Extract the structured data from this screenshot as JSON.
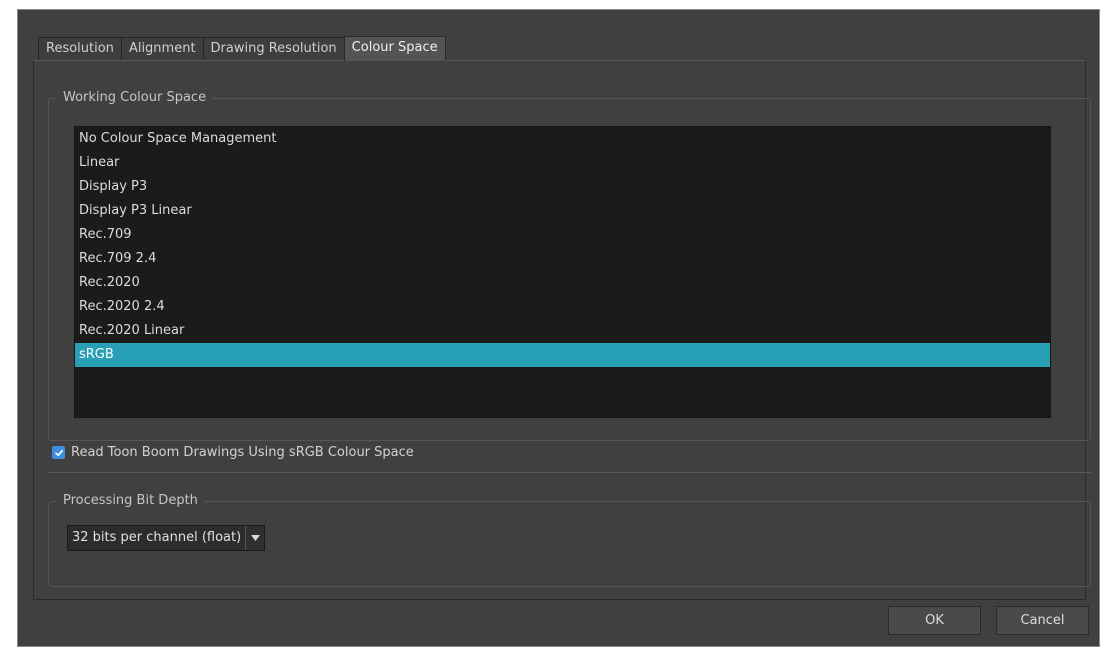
{
  "tabs": [
    "Resolution",
    "Alignment",
    "Drawing Resolution",
    "Colour Space"
  ],
  "active_tab": "Colour Space",
  "working_colour_space": {
    "title": "Working Colour Space",
    "items": [
      "No Colour Space Management",
      "Linear",
      "Display P3",
      "Display P3 Linear",
      "Rec.709",
      "Rec.709 2.4",
      "Rec.2020",
      "Rec.2020 2.4",
      "Rec.2020 Linear",
      "sRGB"
    ],
    "selected": "sRGB"
  },
  "read_toon_boom": {
    "label": "Read Toon Boom Drawings Using sRGB Colour Space",
    "checked": true
  },
  "processing_bit_depth": {
    "title": "Processing Bit Depth",
    "value": "32 bits per channel (float)"
  },
  "buttons": {
    "ok": "OK",
    "cancel": "Cancel"
  },
  "colors": {
    "dialog_bg": "#404040",
    "list_bg": "#1b1b1b",
    "selection": "#27a0b5",
    "checkbox": "#3d8fde"
  }
}
